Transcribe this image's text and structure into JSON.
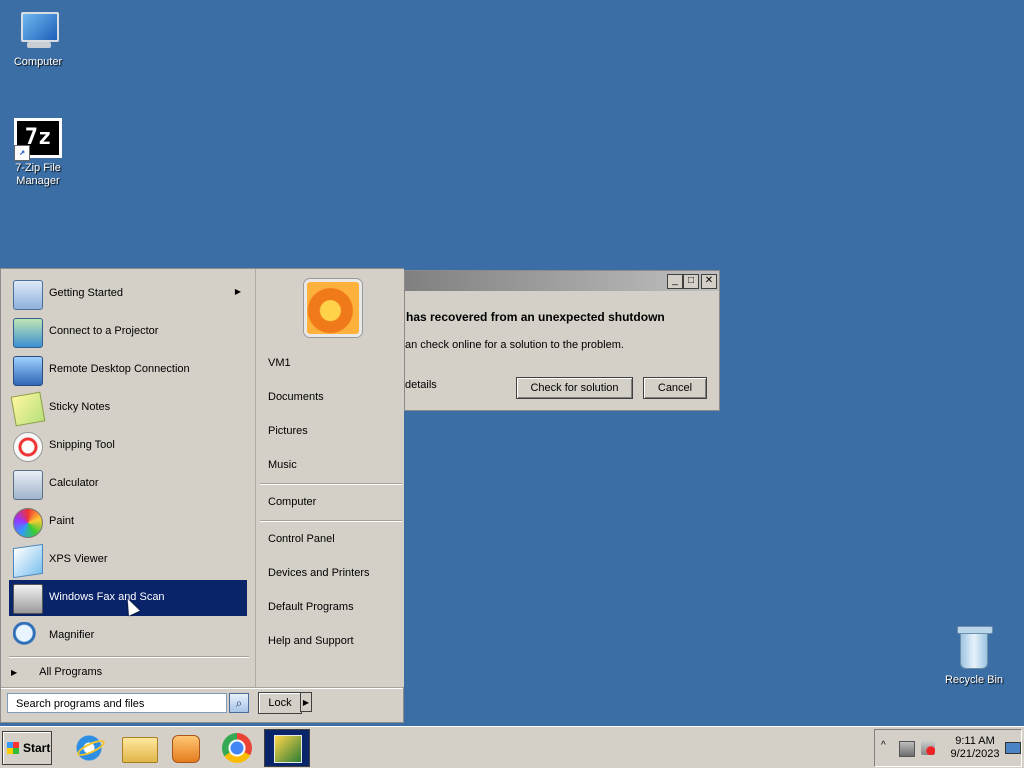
{
  "desktop": {
    "icons": [
      {
        "label": "Computer",
        "icon": "computer-icon"
      },
      {
        "label": "7-Zip File Manager",
        "icon": "7zip-icon",
        "glyph": "7z",
        "shortcut_glyph": "↗"
      },
      {
        "label": "Recycle Bin",
        "icon": "recycle-bin-icon"
      }
    ],
    "background_color": "#3a6ea5"
  },
  "dialog": {
    "heading": "has recovered from an unexpected shutdown",
    "message": "an check online for a solution to the problem.",
    "details_link": "details",
    "buttons": {
      "check": "Check for solution",
      "cancel": "Cancel"
    },
    "window_controls": {
      "minimize": "_",
      "maximize": "□",
      "close": "✕"
    }
  },
  "start_menu": {
    "programs": [
      {
        "label": "Getting Started",
        "icon": "getting-started-icon",
        "has_submenu": true
      },
      {
        "label": "Connect to a Projector",
        "icon": "projector-icon"
      },
      {
        "label": "Remote Desktop Connection",
        "icon": "remote-desktop-icon"
      },
      {
        "label": "Sticky Notes",
        "icon": "sticky-notes-icon"
      },
      {
        "label": "Snipping Tool",
        "icon": "snipping-tool-icon"
      },
      {
        "label": "Calculator",
        "icon": "calculator-icon"
      },
      {
        "label": "Paint",
        "icon": "paint-icon"
      },
      {
        "label": "XPS Viewer",
        "icon": "xps-viewer-icon"
      },
      {
        "label": "Windows Fax and Scan",
        "icon": "fax-scan-icon",
        "selected": true
      },
      {
        "label": "Magnifier",
        "icon": "magnifier-icon"
      }
    ],
    "all_programs": "All Programs",
    "submenu_glyph": "▶",
    "search_placeholder": "Search programs and files",
    "search_button_glyph": "⌕",
    "right_items": [
      {
        "label": "VM1"
      },
      {
        "label": "Documents"
      },
      {
        "label": "Pictures"
      },
      {
        "label": "Music"
      },
      {
        "label": "Computer"
      },
      {
        "label": "Control Panel"
      },
      {
        "label": "Devices and Printers"
      },
      {
        "label": "Default Programs"
      },
      {
        "label": "Help and Support"
      }
    ],
    "lock_label": "Lock",
    "lock_arrow_glyph": "▶",
    "selection_color": "#0a246a"
  },
  "taskbar": {
    "start_label": "Start",
    "pinned": [
      "internet-explorer-icon",
      "explorer-folder-icon",
      "media-player-icon",
      "chrome-icon",
      "active-app-icon"
    ],
    "tray": {
      "chevron": "^",
      "time": "9:11 AM",
      "date": "9/21/2023"
    }
  }
}
